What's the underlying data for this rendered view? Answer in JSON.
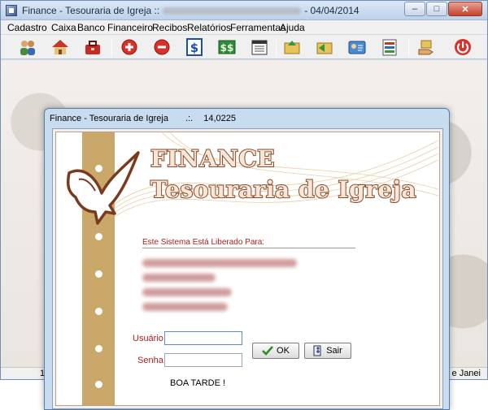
{
  "main_window": {
    "title_app": "Finance - Tesouraria de Igreja ::",
    "title_date": "- 04/04/2014",
    "buttons": {
      "minimize": "–",
      "maximize": "□",
      "close": "✕"
    }
  },
  "menu": [
    "Cadastro",
    "Caixa",
    "Banco",
    "Financeiro",
    "Recibos",
    "Relatórios",
    "Ferramentas",
    "Ajuda"
  ],
  "toolbar": {
    "icons": [
      "members-icon",
      "church-icon",
      "toolbox-icon",
      "add-entry-icon",
      "remove-entry-icon",
      "dollar-icon",
      "cash-icon",
      "calendar-icon",
      "folder-up-icon",
      "folder-in-icon",
      "id-card-icon",
      "reports-icon",
      "money-hand-icon",
      "power-icon"
    ]
  },
  "statusbar": {
    "left": "1",
    "right": "e Janei"
  },
  "dialog": {
    "title": "Finance - Tesouraria de Igreja",
    "version_sep": ".:.",
    "version": "14,0225",
    "logo_line1": "FINANCE",
    "logo_line2": "Tesouraria de Igreja",
    "licensed_label": "Este Sistema Está Liberado Para:",
    "user_label": "Usuário",
    "password_label": "Senha",
    "user_value": "",
    "password_value": "",
    "ok_label": "OK",
    "exit_label": "Sair",
    "greeting": "BOA TARDE !",
    "colors": {
      "accent_red": "#b0201e",
      "logo_brown": "#8a4a2a",
      "stripe_gold": "#c9a86a"
    }
  }
}
